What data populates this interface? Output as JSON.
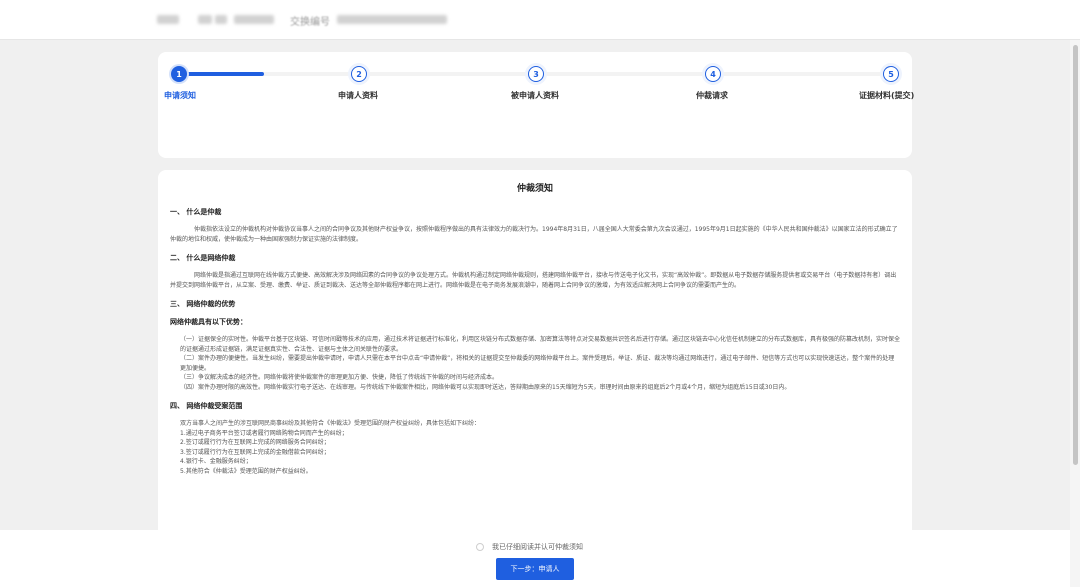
{
  "header": {
    "title": "交换编号"
  },
  "steps": [
    {
      "number": "1",
      "label": "申请须知",
      "active": true
    },
    {
      "number": "2",
      "label": "申请人资料",
      "active": false
    },
    {
      "number": "3",
      "label": "被申请人资料",
      "active": false
    },
    {
      "number": "4",
      "label": "仲裁请求",
      "active": false
    },
    {
      "number": "5",
      "label": "证据材料(提交)",
      "active": false
    }
  ],
  "progress": 0.12,
  "notice": {
    "title": "仲裁须知",
    "sections": {
      "s1": {
        "heading": "一、 什么是仲裁",
        "body": "仲裁指依法设立的仲裁机构对仲裁协议当事人之间的合同争议及其他财产权益争议，按照仲裁程序做出的具有法律效力的裁决行为。1994年8月31日，八届全国人大常委会第九次会议通过，1995年9月1日起实施的《中华人民共和国仲裁法》以国家立法的形式确立了仲裁的地位和权威，使仲裁成为一种由国家强制力保证实施的法律制度。"
      },
      "s2": {
        "heading": "二、 什么是网络仲裁",
        "body": "网络仲裁是指通过互联网在线仲裁方式便捷、高效解决涉及网络因素的合同争议的争议处理方式。仲裁机构通过制定网络仲裁规则，搭建网络仲裁平台，接收与传送电子化文书，实现“高效仲裁”。即数据从电子数据存储服务提供者或交易平台（电子数据持有者）调出并提交到网络仲裁平台，从立案、受理、缴费、举证、质证到裁决、送达等全部仲裁程序都在网上进行。网络仲裁是在电子商务发展浪潮中，随着网上合同争议的激增，为有效适应解决网上合同争议的需要而产生的。"
      },
      "s3": {
        "heading": "三、 网络仲裁的优势",
        "subheading": "网络仲裁具有以下优势：",
        "items": [
          "（一）证据保全的实时性。仲裁平台基于区块链、可信时间戳等技术的应用，通过技术将证据进行标准化，利用区块链分布式数据存储、加密算法等特点对交易数据共识签名后进行存储。通过区块链去中心化信任机制建立的分布式数据库，具有极强的防篡改机制，实时保全的证据通过形成证据链，满足证据真实性、合法性、证据与主体之间关联性的要求。",
          "（二）案件办理的便捷性。当发生纠纷，需要提出仲裁申请时，申请人只需在本平台中点击“申请仲裁”，将相关的证据提交至仲裁委的网络仲裁平台上。案件受理后，举证、质证、裁决等均通过网络进行，通过电子邮件、短信等方式也可以实现快速送达，整个案件的处理更加便捷。",
          "（三）争议解决成本的经济性。网络仲裁将使仲裁案件的审理更加方便、快捷，降低了传统线下仲裁的时间与经济成本。",
          "（四）案件办理时限的高效性。网络仲裁实行电子送达、在线审理。与传统线下仲裁案件相比，网络仲裁可以实现即时送达，答辩期由原来的15天缩短为5天，审理时间由原来的组庭后2个月或4个月，缩短为组庭后15日或30日内。"
        ]
      },
      "s4": {
        "heading": "四、 网络仲裁受案范围",
        "intro": "双方当事人之间产生的涉互联网民商事纠纷及其他符合《仲裁法》受理范围的财产权益纠纷，具体包括如下纠纷：",
        "items": [
          "1.通过电子商务平台签订或者履行网络购物合同而产生的纠纷；",
          "2.签订或履行行为在互联网上完成的网络服务合同纠纷；",
          "3.签订或履行行为在互联网上完成的金融借款合同纠纷；",
          "4.银行卡、金融服务纠纷；",
          "5.其他符合《仲裁法》受理范围的财产权益纠纷。"
        ]
      }
    }
  },
  "footer": {
    "agree_label": "我已仔细阅读并认可仲裁须知",
    "next_label": "下一步：申请人"
  }
}
